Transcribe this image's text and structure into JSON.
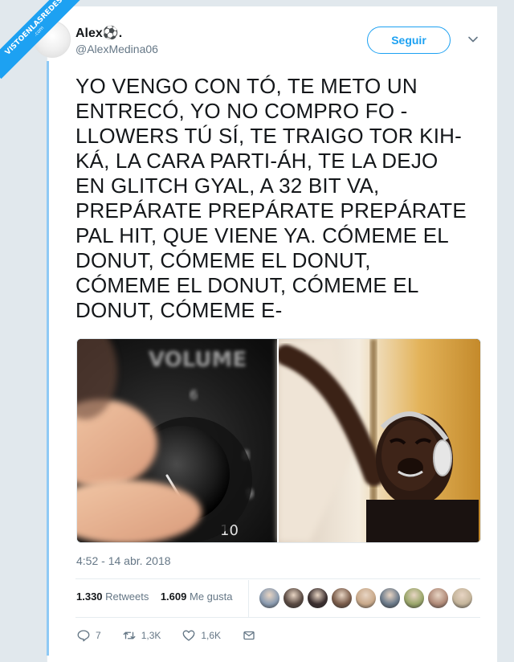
{
  "watermark": {
    "text": "VISTOENLASREDES",
    "sub": ".com"
  },
  "tweet": {
    "display_name": "Alex⚽.",
    "handle": "@AlexMedina06",
    "follow_label": "Seguir",
    "text": "YO VENGO CON TÓ, TE METO UN ENTRECÓ, YO NO COMPRO FO - LLOWERS TÚ SÍ, TE TRAIGO TOR KIH-KÁ, LA CARA PARTI-ÁH, TE LA DEJO EN GLITCH GYAL, A 32 BIT VA, PREPÁRATE PREPÁRATE PREPÁRATE PAL HIT, QUE VIENE YA. CÓMEME EL DONUT, CÓMEME EL DONUT, CÓMEME EL DONUT, CÓMEME EL DONUT, CÓMEME E-",
    "text_lines": [
      "YO VENGO CON TÓ, TE METO UN",
      "ENTRECÓ, YO NO COMPRO FO -",
      "LLOWERS TÚ SÍ, TE TRAIGO TOR KIH-",
      "KÁ, LA CARA PARTI-ÁH, TE LA DEJO",
      "EN GLITCH GYAL, A 32 BIT VA,",
      "PREPÁRATE PREPÁRATE PREPÁRATE",
      "PAL HIT, QUE VIENE YA. CÓMEME EL",
      "DONUT, CÓMEME EL DONUT,",
      "CÓMEME EL DONUT, CÓMEME EL",
      "DONUT, CÓMEME E-"
    ],
    "media": {
      "left_image": "volume-knob-photo",
      "left_image_text": "VOLUME",
      "left_dial_number": "10",
      "right_image": "crying-kid-headphones-photo"
    },
    "timestamp": "4:52 - 14 abr. 2018",
    "retweets_count": "1.330",
    "retweets_label": "Retweets",
    "likes_count": "1.609",
    "likes_label": "Me gusta",
    "liker_avatar_colors": [
      "#8a9bb0",
      "#5a4a42",
      "#3b2f2f",
      "#7a5c4a",
      "#c9a98a",
      "#6b7a8a",
      "#9aa66a",
      "#b08a78",
      "#c4b49a"
    ],
    "actions": {
      "reply_count": "7",
      "retweet_count": "1,3K",
      "like_count": "1,6K"
    }
  },
  "icons": {
    "reply": "reply-icon",
    "retweet": "retweet-icon",
    "like": "heart-icon",
    "dm": "envelope-icon",
    "more": "chevron-down-icon"
  },
  "colors": {
    "accent": "#1da1f2",
    "text": "#14171a",
    "secondary": "#657786"
  }
}
